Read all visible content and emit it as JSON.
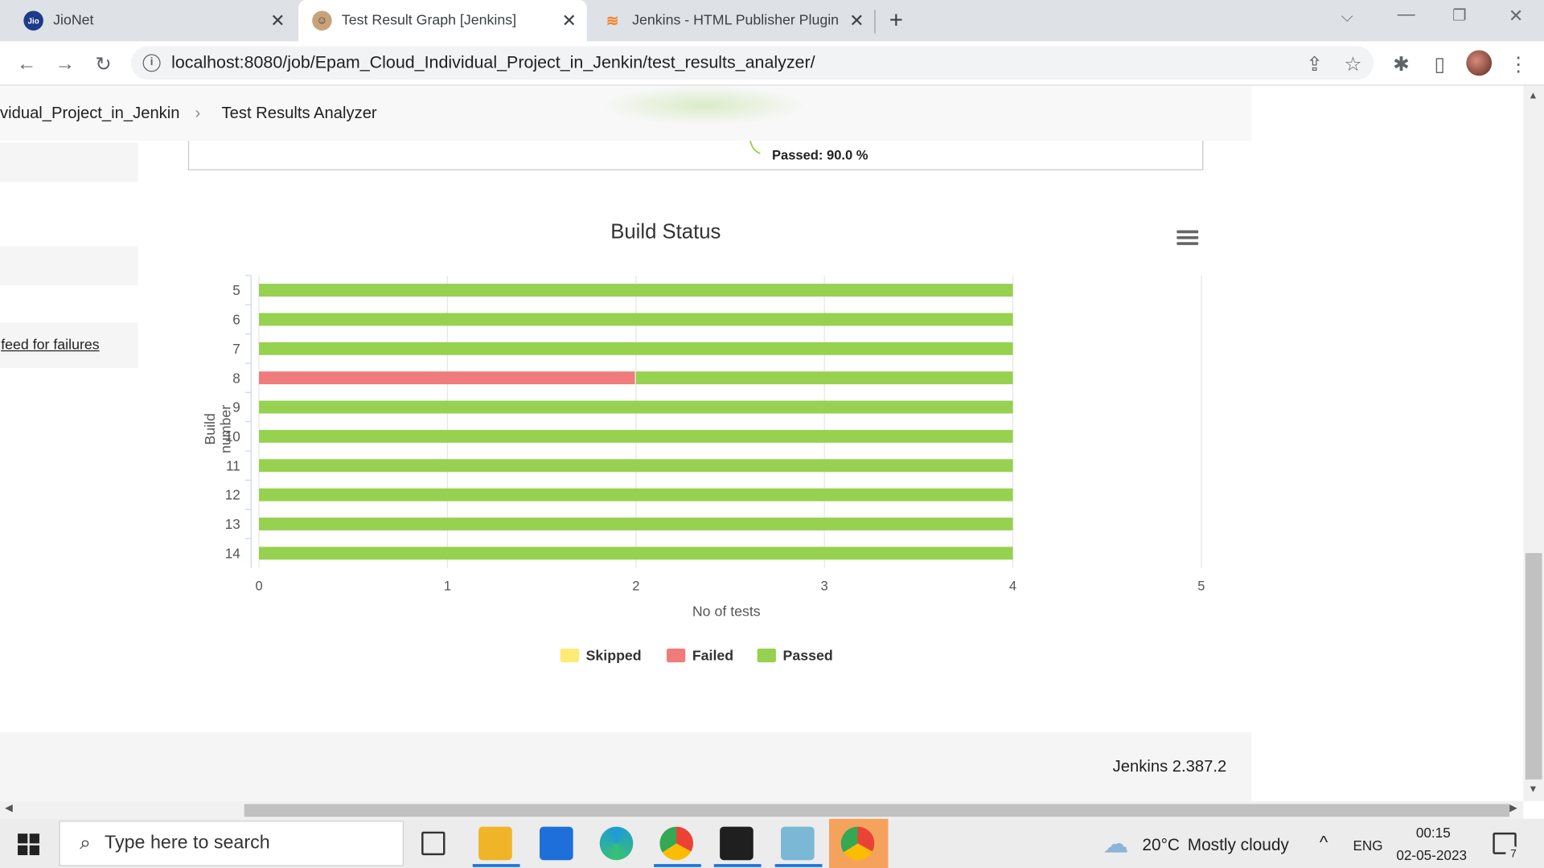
{
  "browser": {
    "tabs": [
      {
        "title": "JioNet",
        "favicon": "jio-logo-icon"
      },
      {
        "title": "Test Result Graph [Jenkins]",
        "favicon": "jenkins-butler-icon"
      },
      {
        "title": "Jenkins - HTML Publisher Plugin",
        "favicon": "stackoverflow-icon"
      }
    ],
    "url": "localhost:8080/job/Epam_Cloud_Individual_Project_in_Jenkin/test_results_analyzer/"
  },
  "breadcrumb": {
    "items": [
      "vidual_Project_in_Jenkin",
      "Test Results Analyzer"
    ]
  },
  "sidebar": {
    "link": "feed for failures"
  },
  "pie_fragment": {
    "label": "Passed: 90.0 %"
  },
  "chart_data": {
    "type": "bar",
    "orientation": "horizontal",
    "stacked": true,
    "title": "Build Status",
    "xlabel": "No of tests",
    "ylabel": "Build number",
    "categories": [
      "5",
      "6",
      "7",
      "8",
      "9",
      "10",
      "11",
      "12",
      "13",
      "14"
    ],
    "xlim": [
      0,
      5
    ],
    "xticks": [
      "0",
      "1",
      "2",
      "3",
      "4",
      "5"
    ],
    "series": [
      {
        "name": "Skipped",
        "color": "#ffeb73",
        "values": [
          0,
          0,
          0,
          0,
          0,
          0,
          0,
          0,
          0,
          0
        ]
      },
      {
        "name": "Failed",
        "color": "#f07b7b",
        "values": [
          0,
          0,
          0,
          2,
          0,
          0,
          0,
          0,
          0,
          0
        ]
      },
      {
        "name": "Passed",
        "color": "#96d150",
        "values": [
          4,
          4,
          4,
          2,
          4,
          4,
          4,
          4,
          4,
          4
        ]
      }
    ],
    "grid": true,
    "legend_position": "bottom"
  },
  "footer": {
    "version": "Jenkins 2.387.2"
  },
  "taskbar": {
    "search_placeholder": "Type here to search",
    "weather_temp": "20°C",
    "weather_text": "Mostly cloudy",
    "language": "ENG",
    "time": "00:15",
    "date": "02-05-2023",
    "notification_count": "7"
  },
  "colors": {
    "tabstrip": "#dee1e6",
    "passed": "#96d150",
    "failed": "#f07b7b",
    "skipped": "#ffeb73"
  }
}
